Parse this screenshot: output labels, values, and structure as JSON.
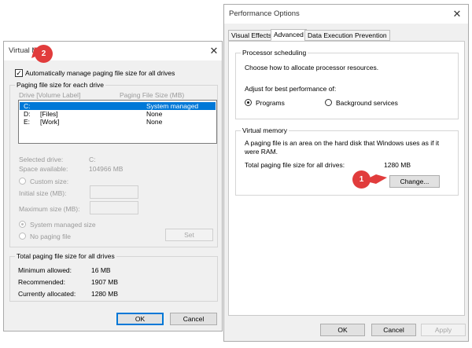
{
  "perf": {
    "title": "Performance Options",
    "close": "✕",
    "tabs": [
      "Visual Effects",
      "Advanced",
      "Data Execution Prevention"
    ],
    "processor": {
      "title": "Processor scheduling",
      "desc": "Choose how to allocate processor resources.",
      "adjust": "Adjust for best performance of:",
      "programs": "Programs",
      "background": "Background services"
    },
    "vm": {
      "title": "Virtual memory",
      "desc": "A paging file is an area on the hard disk that Windows uses as if it were RAM.",
      "total_label": "Total paging file size for all drives:",
      "total_value": "1280 MB",
      "change": "Change..."
    },
    "ok": "OK",
    "cancel": "Cancel",
    "apply": "Apply"
  },
  "vmem": {
    "title": "Virtual M",
    "close": "✕",
    "auto_manage": "Automatically manage paging file size for all drives",
    "auto_checked": "✓",
    "paging_group": "Paging file size for each drive",
    "col_drive": "Drive  [Volume Label]",
    "col_size": "Paging File Size (MB)",
    "drives": [
      {
        "drive": "C:",
        "label": "",
        "size": "System managed"
      },
      {
        "drive": "D:",
        "label": "[Files]",
        "size": "None"
      },
      {
        "drive": "E:",
        "label": "[Work]",
        "size": "None"
      }
    ],
    "selected_drive_label": "Selected drive:",
    "selected_drive_value": "C:",
    "space_label": "Space available:",
    "space_value": "104966 MB",
    "custom_size": "Custom size:",
    "initial_size": "Initial size (MB):",
    "max_size": "Maximum size (MB):",
    "system_managed": "System managed size",
    "no_paging": "No paging file",
    "set": "Set",
    "total_group": "Total paging file size for all drives",
    "min_label": "Minimum allowed:",
    "min_value": "16 MB",
    "rec_label": "Recommended:",
    "rec_value": "1907 MB",
    "cur_label": "Currently allocated:",
    "cur_value": "1280 MB",
    "ok": "OK",
    "cancel": "Cancel"
  },
  "badges": {
    "one": "1",
    "two": "2"
  },
  "colors": {
    "accent": "#0078d7",
    "badge": "#e13c3c"
  }
}
